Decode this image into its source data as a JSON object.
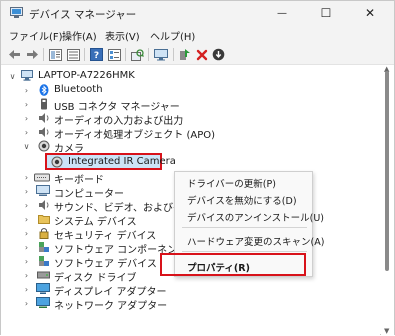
{
  "window": {
    "title": "デバイス マネージャー",
    "controls": {
      "minimize": "—",
      "maximize": "☐",
      "close": "✕"
    }
  },
  "menubar": {
    "items": [
      "ファイル(F)",
      "操作(A)",
      "表示(V)",
      "ヘルプ(H)"
    ]
  },
  "toolbar": {
    "icons": [
      "back-arrow-icon",
      "forward-arrow-icon",
      "properties-pane-icon",
      "device-list-icon",
      "help-icon",
      "devices-view-icon",
      "scan-icon",
      "computer-icon",
      "update-driver-icon",
      "uninstall-icon",
      "disable-device-icon"
    ]
  },
  "tree": {
    "root": "LAPTOP-A7226HMK",
    "items": [
      "Bluetooth",
      "USB コネクタ マネージャー",
      "オーディオの入力および出力",
      "オーディオ処理オブジェクト (APO)",
      "カメラ",
      "Integrated IR Camera",
      "キーボード",
      "コンピューター",
      "サウンド、ビデオ、およびゲーム",
      "システム デバイス",
      "セキュリティ デバイス",
      "ソフトウェア コンポーネント",
      "ソフトウェア デバイス",
      "ディスク ドライブ",
      "ディスプレイ アダプター",
      "ネットワーク アダプター"
    ]
  },
  "context_menu": {
    "update_driver": "ドライバーの更新(P)",
    "disable_device": "デバイスを無効にする(D)",
    "uninstall_device": "デバイスのアンインストール(U)",
    "scan_hardware": "ハードウェア変更のスキャン(A)",
    "properties": "プロパティ(R)"
  },
  "colors": {
    "highlight_border": "#d8121a",
    "selection_fill": "#cce4f7",
    "bluetooth_blue": "#1a73e8",
    "chrome": "#f3f3f3"
  }
}
